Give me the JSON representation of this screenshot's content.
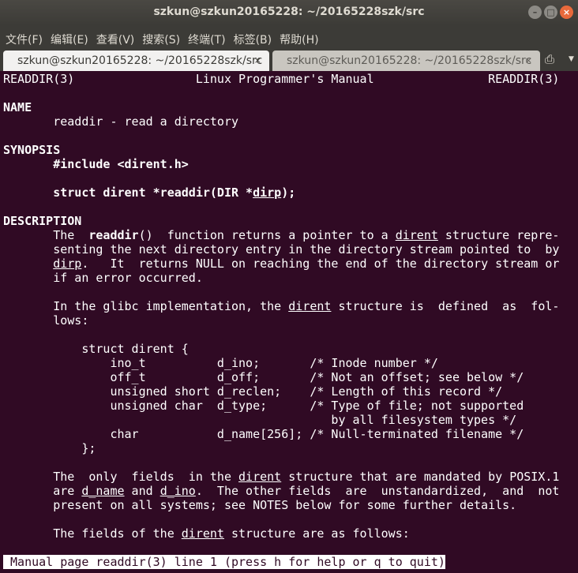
{
  "window": {
    "title": "szkun@szkun20165228: ~/20165228szk/src",
    "buttons": [
      "–",
      "□",
      "×"
    ]
  },
  "menu": [
    "文件(F)",
    "编辑(E)",
    "查看(V)",
    "搜索(S)",
    "终端(T)",
    "标签(B)",
    "帮助(H)"
  ],
  "tabs": [
    {
      "label": "szkun@szkun20165228: ~/20165228szk/src",
      "close": "×",
      "active": true
    },
    {
      "label": "szkun@szkun20165228: ~/20165228szk/src",
      "close": "×",
      "active": false
    }
  ],
  "icons": {
    "new_tab": "new-tab-icon",
    "tab_menu": "chevron-down-icon"
  },
  "colors": {
    "terminal_bg": "#300a24",
    "text": "#ffffff",
    "titlebar": "#3c3b37",
    "close_button": "#e8693b"
  },
  "terminal": {
    "lines": [
      [
        [
          "READDIR(3)                 Linux Programmer's Manual                READDIR(3)",
          ""
        ]
      ],
      [],
      [
        [
          "NAME",
          "b"
        ]
      ],
      [
        [
          "       readdir - read a directory",
          ""
        ]
      ],
      [],
      [
        [
          "SYNOPSIS",
          "b"
        ]
      ],
      [
        [
          "       #include <dirent.h>",
          "b"
        ]
      ],
      [],
      [
        [
          "       struct dirent *readdir(DIR *",
          "b"
        ],
        [
          "dirp",
          "bu"
        ],
        [
          ");",
          "b"
        ]
      ],
      [],
      [
        [
          "DESCRIPTION",
          "b"
        ]
      ],
      [
        [
          "       The  ",
          ""
        ],
        [
          "readdir",
          "b"
        ],
        [
          "()  function returns a pointer to a ",
          ""
        ],
        [
          "dirent",
          "u"
        ],
        [
          " structure repre‐",
          ""
        ]
      ],
      [
        [
          "       senting the next directory entry in the directory stream pointed to  by",
          ""
        ]
      ],
      [
        [
          "       ",
          ""
        ],
        [
          "dirp",
          "u"
        ],
        [
          ".   It  returns NULL on reaching the end of the directory stream or",
          ""
        ]
      ],
      [
        [
          "       if an error occurred.",
          ""
        ]
      ],
      [],
      [
        [
          "       In the glibc implementation, the ",
          ""
        ],
        [
          "dirent",
          "u"
        ],
        [
          " structure is  defined  as  fol‐",
          ""
        ]
      ],
      [
        [
          "       lows:",
          ""
        ]
      ],
      [],
      [
        [
          "           struct dirent {",
          ""
        ]
      ],
      [
        [
          "               ino_t          d_ino;       /* Inode number */",
          ""
        ]
      ],
      [
        [
          "               off_t          d_off;       /* Not an offset; see below */",
          ""
        ]
      ],
      [
        [
          "               unsigned short d_reclen;    /* Length of this record */",
          ""
        ]
      ],
      [
        [
          "               unsigned char  d_type;      /* Type of file; not supported",
          ""
        ]
      ],
      [
        [
          "                                              by all filesystem types */",
          ""
        ]
      ],
      [
        [
          "               char           d_name[256]; /* Null-terminated filename */",
          ""
        ]
      ],
      [
        [
          "           };",
          ""
        ]
      ],
      [],
      [
        [
          "       The  only  fields  in the ",
          ""
        ],
        [
          "dirent",
          "u"
        ],
        [
          " structure that are mandated by POSIX.1",
          ""
        ]
      ],
      [
        [
          "       are ",
          ""
        ],
        [
          "d_name",
          "u"
        ],
        [
          " and ",
          ""
        ],
        [
          "d_ino",
          "u"
        ],
        [
          ".  The other fields  are  unstandardized,  and  not",
          ""
        ]
      ],
      [
        [
          "       present on all systems; see NOTES below for some further details.",
          ""
        ]
      ],
      [],
      [
        [
          "       The fields of the ",
          ""
        ],
        [
          "dirent",
          "u"
        ],
        [
          " structure are as follows:",
          ""
        ]
      ],
      []
    ],
    "status": " Manual page readdir(3) line 1 (press h for help or q to quit)"
  }
}
